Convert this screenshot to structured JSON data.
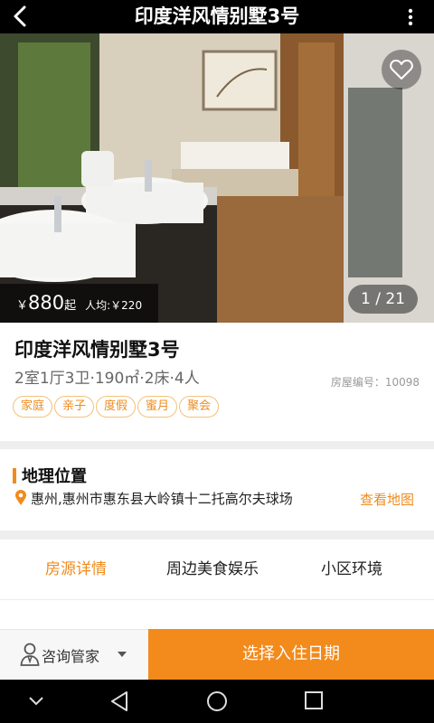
{
  "header": {
    "title": "印度洋风情别墅3号",
    "back_icon": "back-arrow-icon",
    "more_icon": "more-vertical-icon"
  },
  "gallery": {
    "favorite_icon": "heart-outline-icon",
    "price_symbol": "￥",
    "price": "880",
    "price_suffix": "起",
    "per_person": "人均:￥220",
    "counter": "1 / 21"
  },
  "listing": {
    "name": "印度洋风情别墅3号",
    "spec": "2室1厅3卫·190㎡·2床·4人",
    "code": "房屋编号：10098",
    "tags": [
      "家庭",
      "亲子",
      "度假",
      "蜜月",
      "聚会"
    ]
  },
  "location": {
    "heading": "地理位置",
    "address": "惠州,惠州市惠东县大岭镇十二托高尔夫球场",
    "map_link": "查看地图"
  },
  "tabs": [
    {
      "label": "房源详情",
      "active": true
    },
    {
      "label": "周边美食娱乐",
      "active": false
    },
    {
      "label": "小区环境",
      "active": false
    }
  ],
  "actions": {
    "consult_label": "咨询管家",
    "book_label": "选择入住日期"
  },
  "colors": {
    "accent": "#f28a1c",
    "accent_text": "#ee8c1e",
    "tag_border": "#f3c27a"
  }
}
